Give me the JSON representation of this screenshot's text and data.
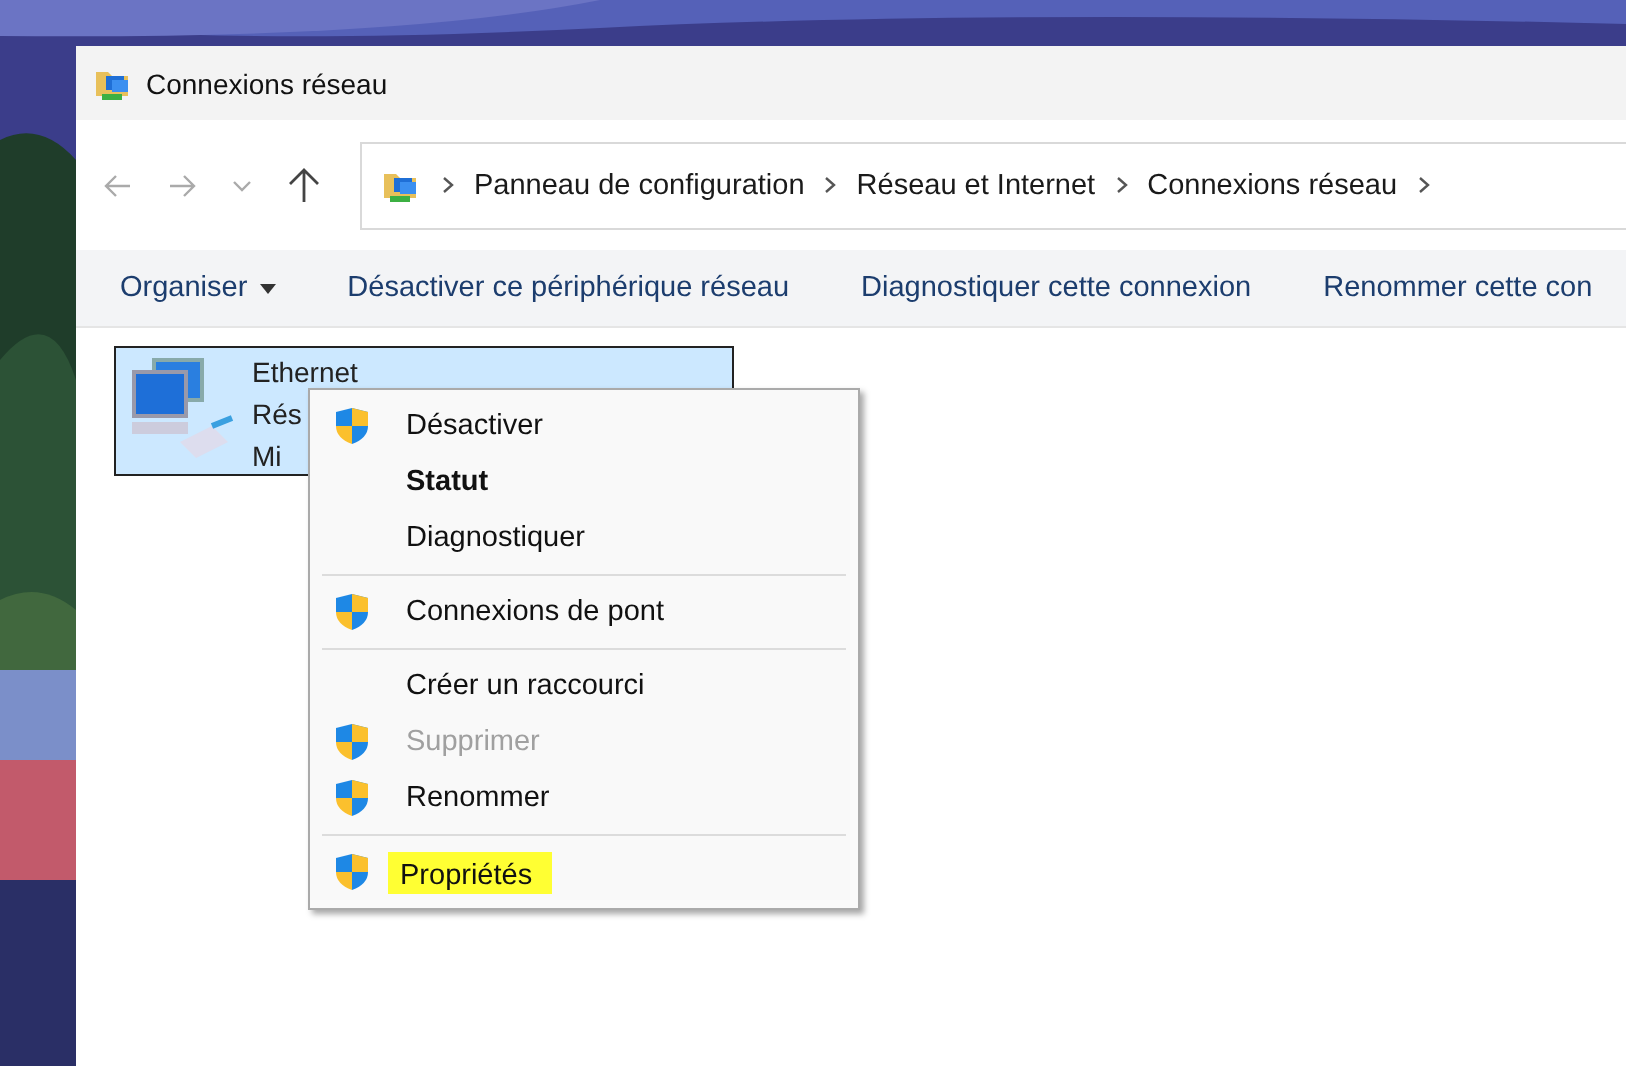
{
  "window": {
    "title": "Connexions réseau"
  },
  "address_bar": {
    "breadcrumbs": [
      "Panneau de configuration",
      "Réseau et Internet",
      "Connexions réseau"
    ]
  },
  "command_bar": [
    {
      "label": "Organiser",
      "dropdown": true
    },
    {
      "label": "Désactiver ce périphérique réseau",
      "dropdown": false
    },
    {
      "label": "Diagnostiquer cette connexion",
      "dropdown": false
    },
    {
      "label": "Renommer cette con",
      "dropdown": false
    }
  ],
  "connections": [
    {
      "name": "Ethernet",
      "lines": [
        "Rés",
        "Mi"
      ],
      "selected": true
    }
  ],
  "context_menu": [
    {
      "kind": "item",
      "label": "Désactiver",
      "shield": true,
      "bold": false,
      "disabled": false,
      "highlighted": false
    },
    {
      "kind": "item",
      "label": "Statut",
      "shield": false,
      "bold": true,
      "disabled": false,
      "highlighted": false
    },
    {
      "kind": "item",
      "label": "Diagnostiquer",
      "shield": false,
      "bold": false,
      "disabled": false,
      "highlighted": false
    },
    {
      "kind": "separator"
    },
    {
      "kind": "item",
      "label": "Connexions de pont",
      "shield": true,
      "bold": false,
      "disabled": false,
      "highlighted": false
    },
    {
      "kind": "separator"
    },
    {
      "kind": "item",
      "label": "Créer un raccourci",
      "shield": false,
      "bold": false,
      "disabled": false,
      "highlighted": false
    },
    {
      "kind": "item",
      "label": "Supprimer",
      "shield": true,
      "bold": false,
      "disabled": true,
      "highlighted": false
    },
    {
      "kind": "item",
      "label": "Renommer",
      "shield": true,
      "bold": false,
      "disabled": false,
      "highlighted": false
    },
    {
      "kind": "separator"
    },
    {
      "kind": "item",
      "label": "Propriétés",
      "shield": true,
      "bold": false,
      "disabled": false,
      "highlighted": true
    }
  ]
}
